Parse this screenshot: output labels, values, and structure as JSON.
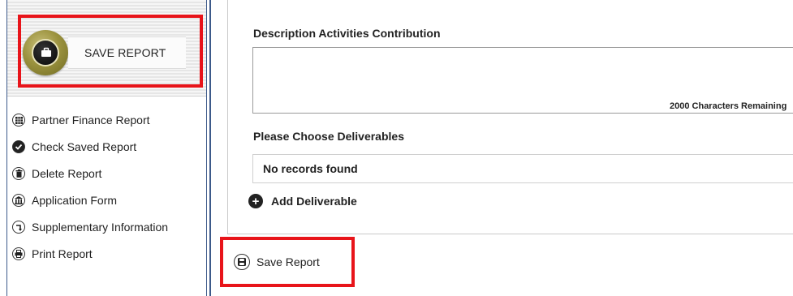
{
  "sidebar": {
    "banner_label": "SAVE REPORT",
    "items": [
      {
        "label": "Partner Finance Report",
        "icon": "table-icon"
      },
      {
        "label": "Check Saved Report",
        "icon": "check-circle-icon"
      },
      {
        "label": "Delete Report",
        "icon": "trash-icon"
      },
      {
        "label": "Application Form",
        "icon": "building-icon"
      },
      {
        "label": "Supplementary Information",
        "icon": "corner-arrow-icon"
      },
      {
        "label": "Print Report",
        "icon": "printer-icon"
      }
    ]
  },
  "main": {
    "description_label": "Description Activities Contribution",
    "description_value": "",
    "chars_remaining": "2000 Characters Remaining",
    "deliverables_label": "Please Choose Deliverables",
    "no_records": "No records found",
    "add_deliverable": "Add Deliverable",
    "save_report": "Save Report"
  },
  "colors": {
    "highlight": "#e8141a",
    "border_blue": "#3d5a8a",
    "banner_disc": "#9c933f"
  }
}
